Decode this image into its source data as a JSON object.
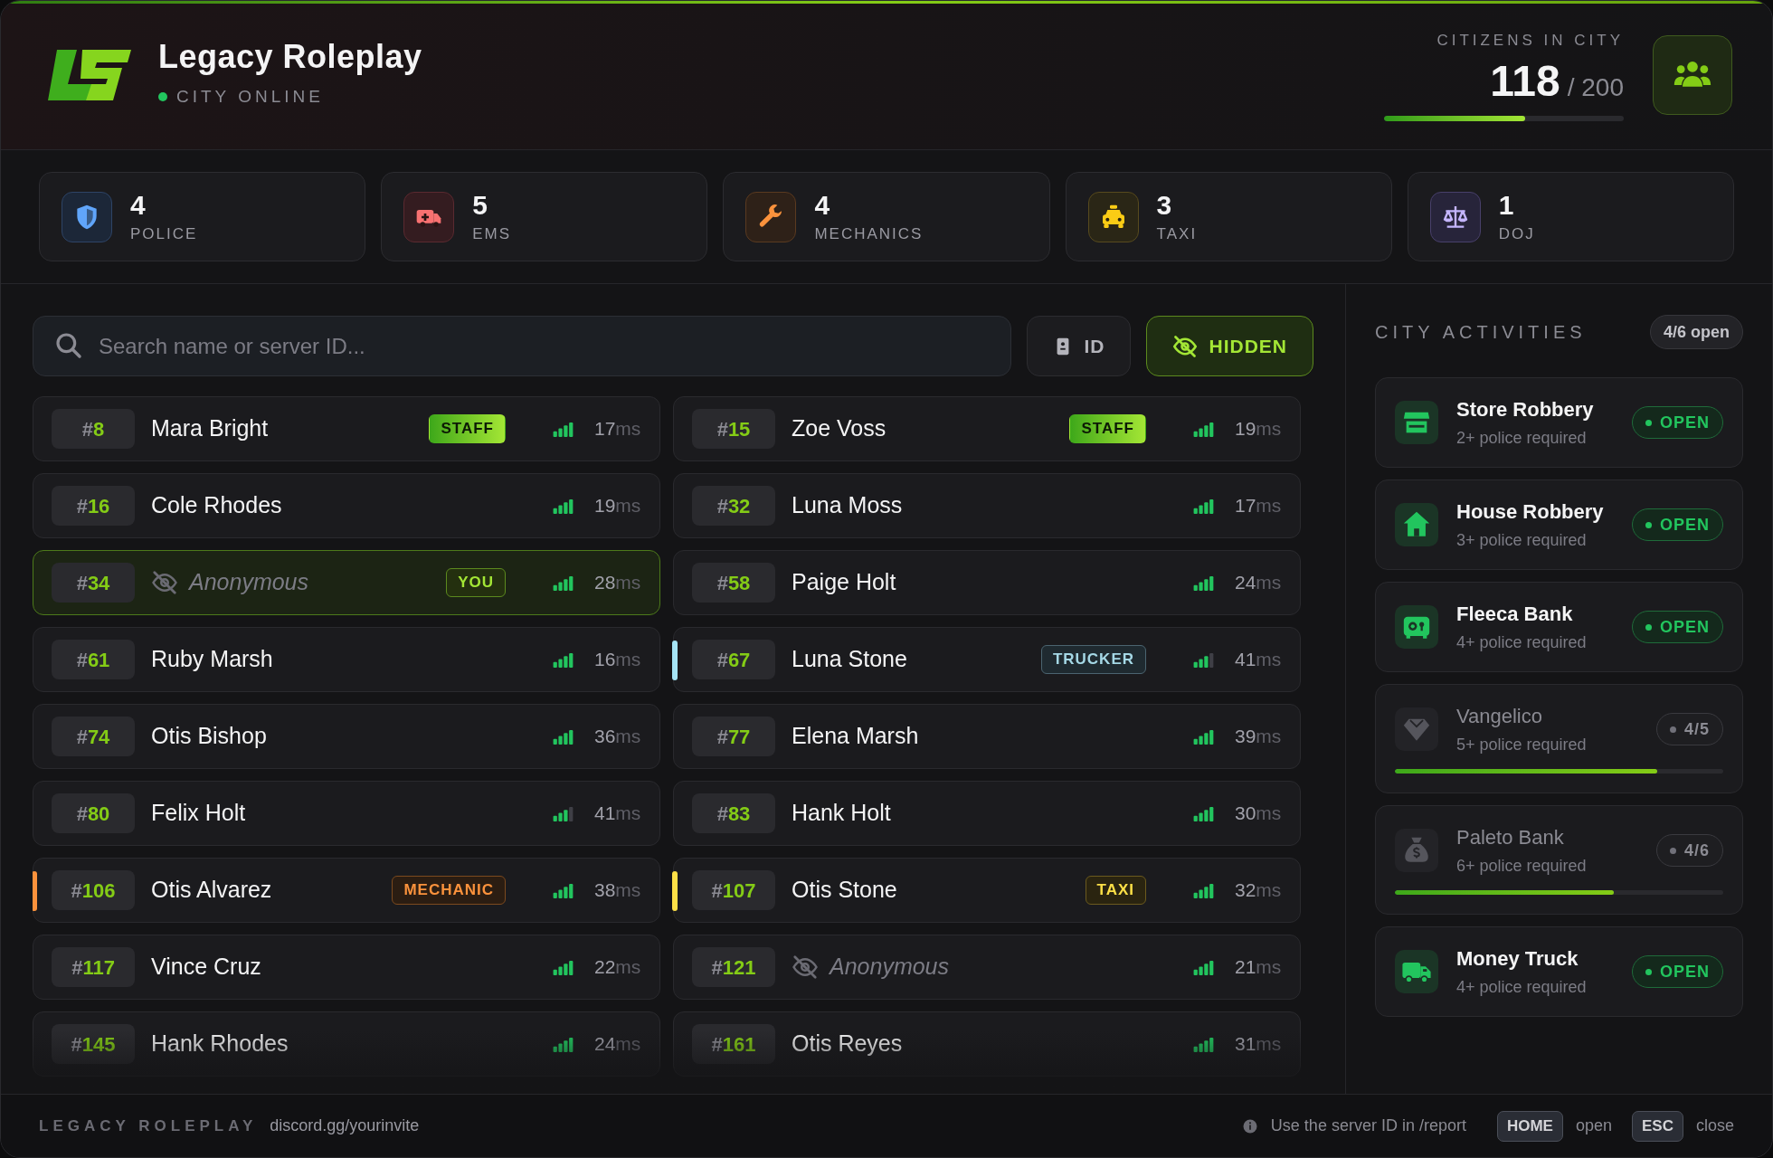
{
  "header": {
    "title": "Legacy Roleplay",
    "status": "CITY ONLINE",
    "online": true,
    "citizens_label": "CITIZENS IN CITY",
    "citizens": "118",
    "capacity": "/ 200",
    "level": 0.59
  },
  "stats": [
    {
      "kind": "police",
      "value": "4",
      "label": "POLICE",
      "color": "#60a5fa"
    },
    {
      "kind": "ems",
      "value": "5",
      "label": "EMS",
      "color": "#f87171"
    },
    {
      "kind": "mechanic",
      "value": "4",
      "label": "MECHANICS",
      "color": "#fb923c"
    },
    {
      "kind": "taxi",
      "value": "3",
      "label": "TAXI",
      "color": "#facc15"
    },
    {
      "kind": "doj",
      "value": "1",
      "label": "DOJ",
      "color": "#c4b5fd"
    }
  ],
  "search": {
    "placeholder": "Search name or server ID..."
  },
  "filters": [
    {
      "label": "ID",
      "kind": "id",
      "on": false
    },
    {
      "label": "HIDDEN",
      "kind": "hidden",
      "on": true
    }
  ],
  "players": [
    {
      "id": "#8",
      "name": "Mara Bright",
      "anonymous": false,
      "selected": false,
      "tag": {
        "kind": "staff",
        "label": "STAFF"
      },
      "weak_signal": false,
      "ping": "17",
      "unit": "ms"
    },
    {
      "id": "#15",
      "name": "Zoe Voss",
      "anonymous": false,
      "selected": false,
      "tag": {
        "kind": "staff",
        "label": "STAFF"
      },
      "weak_signal": false,
      "ping": "19",
      "unit": "ms"
    },
    {
      "id": "#16",
      "name": "Cole Rhodes",
      "anonymous": false,
      "selected": false,
      "weak_signal": false,
      "ping": "19",
      "unit": "ms"
    },
    {
      "id": "#32",
      "name": "Luna Moss",
      "anonymous": false,
      "selected": false,
      "weak_signal": false,
      "ping": "17",
      "unit": "ms"
    },
    {
      "id": "#34",
      "name": "Anonymous",
      "anonymous": true,
      "selected": true,
      "tag": {
        "kind": "you",
        "label": "YOU"
      },
      "weak_signal": false,
      "ping": "28",
      "unit": "ms"
    },
    {
      "id": "#58",
      "name": "Paige Holt",
      "anonymous": false,
      "selected": false,
      "weak_signal": false,
      "ping": "24",
      "unit": "ms"
    },
    {
      "id": "#61",
      "name": "Ruby Marsh",
      "anonymous": false,
      "selected": false,
      "weak_signal": false,
      "ping": "16",
      "unit": "ms"
    },
    {
      "id": "#67",
      "name": "Luna Stone",
      "anonymous": false,
      "selected": false,
      "color": "#a5e4f5",
      "tag": {
        "kind": "trucker",
        "label": "TRUCKER"
      },
      "weak_signal": true,
      "ping": "41",
      "unit": "ms"
    },
    {
      "id": "#74",
      "name": "Otis Bishop",
      "anonymous": false,
      "selected": false,
      "weak_signal": false,
      "ping": "36",
      "unit": "ms"
    },
    {
      "id": "#77",
      "name": "Elena Marsh",
      "anonymous": false,
      "selected": false,
      "weak_signal": false,
      "ping": "39",
      "unit": "ms"
    },
    {
      "id": "#80",
      "name": "Felix Holt",
      "anonymous": false,
      "selected": false,
      "weak_signal": true,
      "ping": "41",
      "unit": "ms"
    },
    {
      "id": "#83",
      "name": "Hank Holt",
      "anonymous": false,
      "selected": false,
      "weak_signal": false,
      "ping": "30",
      "unit": "ms"
    },
    {
      "id": "#106",
      "name": "Otis Alvarez",
      "anonymous": false,
      "selected": false,
      "color": "#fb923c",
      "tag": {
        "kind": "mechanic",
        "label": "MECHANIC"
      },
      "weak_signal": false,
      "ping": "38",
      "unit": "ms"
    },
    {
      "id": "#107",
      "name": "Otis Stone",
      "anonymous": false,
      "selected": false,
      "color": "#fde047",
      "tag": {
        "kind": "taxi",
        "label": "TAXI"
      },
      "weak_signal": false,
      "ping": "32",
      "unit": "ms"
    },
    {
      "id": "#117",
      "name": "Vince Cruz",
      "anonymous": false,
      "selected": false,
      "weak_signal": false,
      "ping": "22",
      "unit": "ms"
    },
    {
      "id": "#121",
      "name": "Anonymous",
      "anonymous": true,
      "selected": false,
      "weak_signal": false,
      "ping": "21",
      "unit": "ms"
    },
    {
      "id": "#145",
      "name": "Hank Rhodes",
      "anonymous": false,
      "selected": false,
      "weak_signal": false,
      "ping": "24",
      "unit": "ms"
    },
    {
      "id": "#161",
      "name": "Otis Reyes",
      "anonymous": false,
      "selected": false,
      "weak_signal": false,
      "ping": "31",
      "unit": "ms"
    }
  ],
  "activities": {
    "title": "CITY ACTIVITIES",
    "count": "4/6 open",
    "items": [
      {
        "kind": "store",
        "name": "Store Robbery",
        "requirement": "2+ police required",
        "available": true,
        "status": "OPEN"
      },
      {
        "kind": "house",
        "name": "House Robbery",
        "requirement": "3+ police required",
        "available": true,
        "status": "OPEN"
      },
      {
        "kind": "safe",
        "name": "Fleeca Bank",
        "requirement": "4+ police required",
        "available": true,
        "status": "OPEN"
      },
      {
        "kind": "gem",
        "name": "Vangelico",
        "requirement": "5+ police required",
        "available": false,
        "status": "4/5",
        "level": 0.8
      },
      {
        "kind": "moneybag",
        "name": "Paleto Bank",
        "requirement": "6+ police required",
        "available": false,
        "status": "4/6",
        "level": 0.667
      },
      {
        "kind": "truck",
        "name": "Money Truck",
        "requirement": "4+ police required",
        "available": true,
        "status": "OPEN"
      }
    ]
  },
  "footer": {
    "brand": "LEGACY ROLEPLAY",
    "link": "discord.gg/yourinvite",
    "hint": "Use the server ID in /report",
    "keys": [
      {
        "key": "HOME",
        "action": "open"
      },
      {
        "key": "ESC",
        "action": "close"
      }
    ]
  }
}
